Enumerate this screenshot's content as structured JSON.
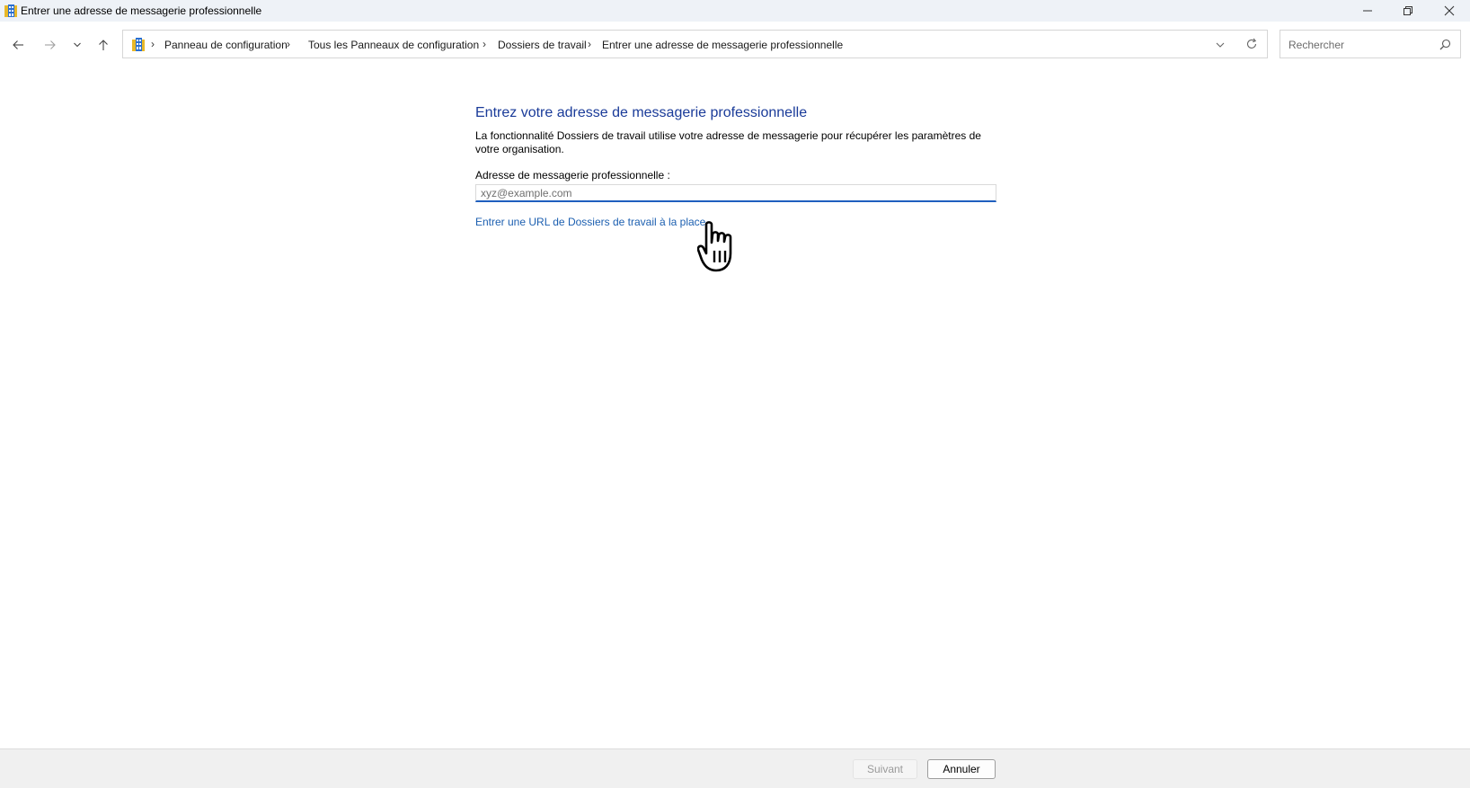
{
  "window": {
    "title": "Entrer une adresse de messagerie professionnelle"
  },
  "nav": {
    "icons": [
      "back-arrow-icon",
      "forward-arrow-icon",
      "chevron-down-icon",
      "up-arrow-icon"
    ]
  },
  "address_bar": {
    "breadcrumbs": [
      "Panneau de configuration",
      "Tous les Panneaux de configuration",
      "Dossiers de travail",
      "Entrer une adresse de messagerie professionnelle"
    ],
    "separator": "›"
  },
  "search": {
    "placeholder": "Rechercher"
  },
  "main": {
    "heading": "Entrez votre adresse de messagerie professionnelle",
    "description": "La fonctionnalité Dossiers de travail utilise votre adresse de messagerie pour récupérer les paramètres de votre organisation.",
    "email_label": "Adresse de messagerie professionnelle :",
    "email_value": "",
    "email_placeholder": "xyz@example.com",
    "url_link": "Entrer une URL de Dossiers de travail à la place"
  },
  "footer": {
    "next_label": "Suivant",
    "cancel_label": "Annuler"
  },
  "colors": {
    "heading": "#1a3b99",
    "link": "#1c5fb0",
    "input_focus": "#1f5fbf",
    "titlebar_bg": "#eef2f7",
    "footer_bg": "#f0f0f0"
  }
}
